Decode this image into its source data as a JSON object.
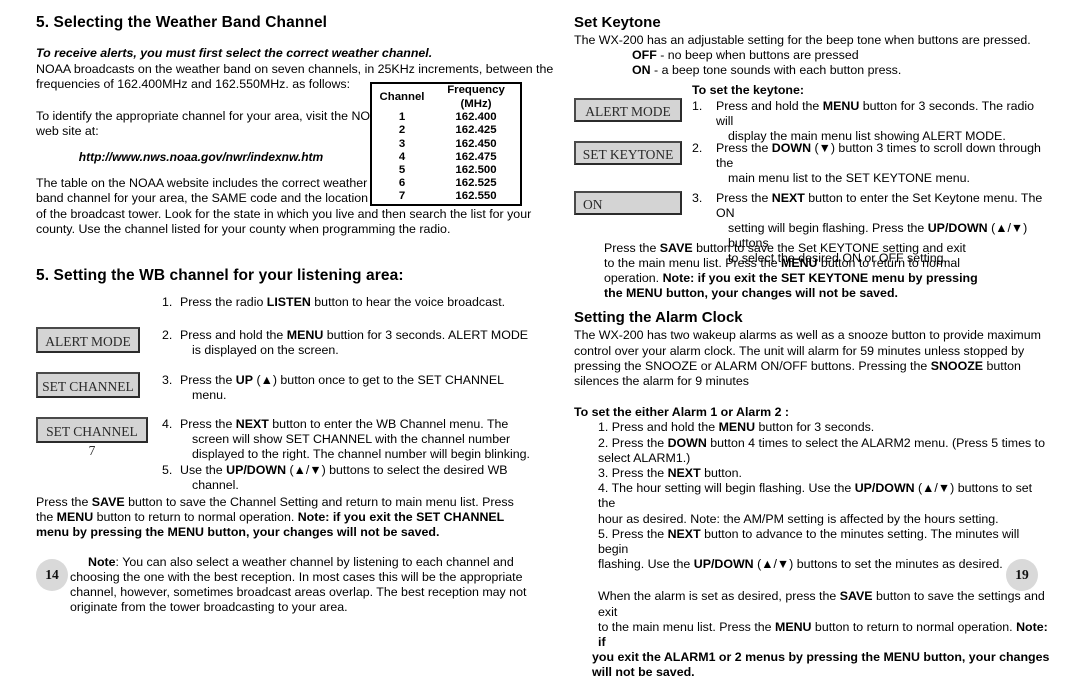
{
  "left": {
    "heading": "5. Selecting the Weather Band Channel",
    "lead": "To receive alerts, you must first select the correct weather channel.",
    "para1_a": "NOAA broadcasts on the weather band on seven channels, in 25KHz increments, between the",
    "para1_b": "frequencies of 162.400MHz and 162.550MHz. as follows:",
    "para2_a": "To identify the appropriate channel for your area, visit the NOAA",
    "para2_b": "web site at:",
    "url": "http://www.nws.noaa.gov/nwr/indexnw.htm",
    "para3_a": "The table on the NOAA website includes the correct weather",
    "para3_b": "band channel for your area, the SAME code and the location",
    "para3_c": "of the broadcast tower.  Look for the state in which you live and then search the list for your",
    "para3_d": "county. Use the channel listed for your county when programming the radio.",
    "heading2": "5. Setting  the WB channel for your listening area:",
    "steps": [
      {
        "num": "1.",
        "line1_pre": "Press the radio ",
        "line1_bold": "LISTEN",
        "line1_post": " button to hear the voice broadcast."
      },
      {
        "num": "2.",
        "lcd": "ALERT MODE",
        "line1_pre": "Press and hold the ",
        "line1_bold": "MENU",
        "line1_post": " buttion for 3 seconds. ALERT MODE",
        "line2": "is displayed on the screen."
      },
      {
        "num": "3.",
        "lcd": "SET CHANNEL",
        "line1_pre": "Press the ",
        "line1_bold": "UP",
        "line1_post": " (▲) button once to get to the SET CHANNEL",
        "line2": "menu."
      },
      {
        "num": "4.",
        "lcd": "SET CHANNEL 7",
        "line1_pre": "Press the ",
        "line1_bold": "NEXT",
        "line1_post": " button to enter the WB Channel menu. The",
        "line2": "screen will show SET CHANNEL with the channel number",
        "line3": "displayed to the right. The channel number will begin blinking."
      },
      {
        "num": "5.",
        "line1_pre": "Use the ",
        "line1_bold": "UP/DOWN",
        "line1_post": " (▲/▼) buttons to select the desired WB",
        "line2": "channel."
      }
    ],
    "save_para": {
      "l1_a": "Press the ",
      "l1_b": "SAVE",
      "l1_c": " button to save the Channel Setting and return to main menu list. Press",
      "l2_a": "the ",
      "l2_b": "MENU",
      "l2_c": " button to return to normal operation. ",
      "l2_d": "Note: if you exit the SET CHANNEL",
      "l3": "menu by pressing the MENU button, your changes will not be saved."
    },
    "note": {
      "label": "Note",
      "l1": ": You can also select a weather channel by listening to each channel and",
      "l2": "choosing the one with the best reception. In most cases this will be the appropriate",
      "l3": "channel, however, sometimes broadcast areas overlap. The best reception may not",
      "l4": "originate from the tower broadcasting to your area."
    },
    "page_number": "14"
  },
  "table": {
    "headers": [
      "Channel",
      "Frequency (MHz)"
    ],
    "rows": [
      [
        "1",
        "162.400"
      ],
      [
        "2",
        "162.425"
      ],
      [
        "3",
        "162.450"
      ],
      [
        "4",
        "162.475"
      ],
      [
        "5",
        "162.500"
      ],
      [
        "6",
        "162.525"
      ],
      [
        "7",
        "162.550"
      ]
    ]
  },
  "right": {
    "heading": "Set Keytone",
    "intro": "The WX-200 has an adjustable setting for the beep tone when buttons are pressed.",
    "off_bold": "OFF",
    "off_rest": " - no beep when buttons are pressed",
    "on_bold": "ON",
    "on_rest": " - a beep tone sounds with each button press.",
    "to_set": "To set the keytone:",
    "steps": [
      {
        "num": "1.",
        "lcd": "ALERT MODE",
        "line1_pre": "Press and hold the ",
        "line1_bold": "MENU",
        "line1_post": " button for 3 seconds. The radio will",
        "line2": "display the main menu list showing ALERT MODE."
      },
      {
        "num": "2.",
        "lcd": "SET KEYTONE",
        "line1_pre": "Press the ",
        "line1_bold": "DOWN",
        "line1_post": " (▼) button 3 times to scroll down through the",
        "line2": "main menu list to the SET KEYTONE menu."
      },
      {
        "num": "3.",
        "lcd": "ON",
        "line1_pre": "Press the ",
        "line1_bold": "NEXT",
        "line1_post": " button to enter the Set Keytone menu. The ON",
        "line2_pre": "setting will begin flashing. Press the ",
        "line2_bold": "UP/DOWN",
        "line2_post": " (▲/▼) buttons",
        "line3": "to select the desired ON or OFF setting.."
      }
    ],
    "save_para": {
      "l1_a": "Press the ",
      "l1_b": "SAVE",
      "l1_c": " button to save the Set KEYTONE setting and exit",
      "l2_a": "to the main menu list. Press the ",
      "l2_b": "MENU",
      "l2_c": " button to return to normal",
      "l3_a": "operation. ",
      "l3_b": "Note: if you exit the SET KEYTONE menu by pressing",
      "l4": "the MENU button, your changes will not be saved."
    },
    "alarm_heading": "Setting the Alarm Clock",
    "alarm_intro_l1": "The WX-200 has two wakeup alarms as well as a snooze button to provide maximum",
    "alarm_intro_l2": "control over your alarm clock. The unit will alarm for 59 minutes unless stopped by",
    "alarm_intro_l3_a": "pressing the SNOOZE or ALARM ON/OFF buttons. Pressing  the ",
    "alarm_intro_l3_b": "SNOOZE",
    "alarm_intro_l3_c": " button",
    "alarm_intro_l4": "silences the alarm for 9 minutes",
    "alarm_subhead": "To set the either Alarm 1 or Alarm 2 :",
    "alarm_steps": [
      {
        "num": "1.",
        "pre": "Press and hold the ",
        "bold": "MENU",
        "post": " button for 3 seconds."
      },
      {
        "num": "2.",
        "pre": "Press the ",
        "bold": "DOWN",
        "post": " button 4 times to select the ALARM2 menu. (Press 5 times to",
        "line2": "select ALARM1.)"
      },
      {
        "num": "3.",
        "pre": "Press the ",
        "bold": "NEXT",
        "post": " button."
      },
      {
        "num": "4.",
        "pre": "The hour setting will begin flashing. Use the ",
        "bold": "UP/DOWN",
        "post": " (▲/▼) buttons to set the",
        "line2": "hour as desired. Note: the AM/PM setting is affected by the hours setting."
      },
      {
        "num": "5.",
        "pre": "Press the ",
        "bold": "NEXT",
        "post": " button to advance to the minutes setting. The minutes will begin",
        "line2_pre": "flashing. Use the ",
        "line2_bold": "UP/DOWN",
        "line2_post": " (▲/▼) buttons to set the minutes as desired."
      }
    ],
    "final_para": {
      "l1_a": "When the alarm is set as desired, press the ",
      "l1_b": "SAVE",
      "l1_c": " button to save the settings and exit",
      "l2_a": "to the main menu list. Press the ",
      "l2_b": "MENU",
      "l2_c": " button to return to normal operation. ",
      "l2_d": "Note: if",
      "l3": "you exit the ALARM1 or 2 menus by pressing the MENU button,  your changes",
      "l4": " will not be saved."
    },
    "page_number": "19"
  }
}
